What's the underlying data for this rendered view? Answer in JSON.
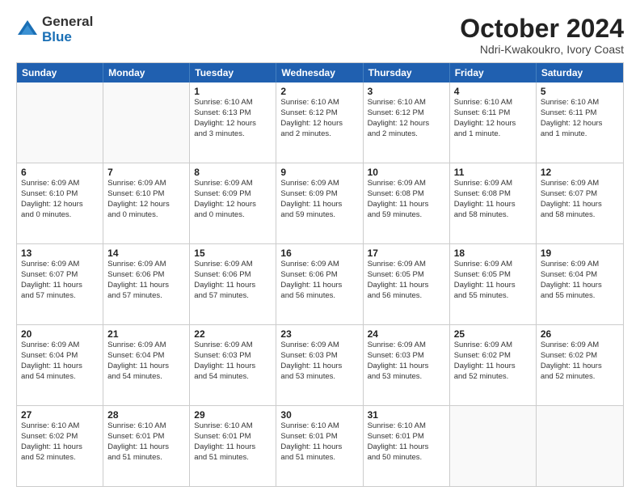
{
  "logo": {
    "general": "General",
    "blue": "Blue"
  },
  "title": "October 2024",
  "location": "Ndri-Kwakoukro, Ivory Coast",
  "header_days": [
    "Sunday",
    "Monday",
    "Tuesday",
    "Wednesday",
    "Thursday",
    "Friday",
    "Saturday"
  ],
  "weeks": [
    [
      {
        "day": "",
        "info": ""
      },
      {
        "day": "",
        "info": ""
      },
      {
        "day": "1",
        "info": "Sunrise: 6:10 AM\nSunset: 6:13 PM\nDaylight: 12 hours\nand 3 minutes."
      },
      {
        "day": "2",
        "info": "Sunrise: 6:10 AM\nSunset: 6:12 PM\nDaylight: 12 hours\nand 2 minutes."
      },
      {
        "day": "3",
        "info": "Sunrise: 6:10 AM\nSunset: 6:12 PM\nDaylight: 12 hours\nand 2 minutes."
      },
      {
        "day": "4",
        "info": "Sunrise: 6:10 AM\nSunset: 6:11 PM\nDaylight: 12 hours\nand 1 minute."
      },
      {
        "day": "5",
        "info": "Sunrise: 6:10 AM\nSunset: 6:11 PM\nDaylight: 12 hours\nand 1 minute."
      }
    ],
    [
      {
        "day": "6",
        "info": "Sunrise: 6:09 AM\nSunset: 6:10 PM\nDaylight: 12 hours\nand 0 minutes."
      },
      {
        "day": "7",
        "info": "Sunrise: 6:09 AM\nSunset: 6:10 PM\nDaylight: 12 hours\nand 0 minutes."
      },
      {
        "day": "8",
        "info": "Sunrise: 6:09 AM\nSunset: 6:09 PM\nDaylight: 12 hours\nand 0 minutes."
      },
      {
        "day": "9",
        "info": "Sunrise: 6:09 AM\nSunset: 6:09 PM\nDaylight: 11 hours\nand 59 minutes."
      },
      {
        "day": "10",
        "info": "Sunrise: 6:09 AM\nSunset: 6:08 PM\nDaylight: 11 hours\nand 59 minutes."
      },
      {
        "day": "11",
        "info": "Sunrise: 6:09 AM\nSunset: 6:08 PM\nDaylight: 11 hours\nand 58 minutes."
      },
      {
        "day": "12",
        "info": "Sunrise: 6:09 AM\nSunset: 6:07 PM\nDaylight: 11 hours\nand 58 minutes."
      }
    ],
    [
      {
        "day": "13",
        "info": "Sunrise: 6:09 AM\nSunset: 6:07 PM\nDaylight: 11 hours\nand 57 minutes."
      },
      {
        "day": "14",
        "info": "Sunrise: 6:09 AM\nSunset: 6:06 PM\nDaylight: 11 hours\nand 57 minutes."
      },
      {
        "day": "15",
        "info": "Sunrise: 6:09 AM\nSunset: 6:06 PM\nDaylight: 11 hours\nand 57 minutes."
      },
      {
        "day": "16",
        "info": "Sunrise: 6:09 AM\nSunset: 6:06 PM\nDaylight: 11 hours\nand 56 minutes."
      },
      {
        "day": "17",
        "info": "Sunrise: 6:09 AM\nSunset: 6:05 PM\nDaylight: 11 hours\nand 56 minutes."
      },
      {
        "day": "18",
        "info": "Sunrise: 6:09 AM\nSunset: 6:05 PM\nDaylight: 11 hours\nand 55 minutes."
      },
      {
        "day": "19",
        "info": "Sunrise: 6:09 AM\nSunset: 6:04 PM\nDaylight: 11 hours\nand 55 minutes."
      }
    ],
    [
      {
        "day": "20",
        "info": "Sunrise: 6:09 AM\nSunset: 6:04 PM\nDaylight: 11 hours\nand 54 minutes."
      },
      {
        "day": "21",
        "info": "Sunrise: 6:09 AM\nSunset: 6:04 PM\nDaylight: 11 hours\nand 54 minutes."
      },
      {
        "day": "22",
        "info": "Sunrise: 6:09 AM\nSunset: 6:03 PM\nDaylight: 11 hours\nand 54 minutes."
      },
      {
        "day": "23",
        "info": "Sunrise: 6:09 AM\nSunset: 6:03 PM\nDaylight: 11 hours\nand 53 minutes."
      },
      {
        "day": "24",
        "info": "Sunrise: 6:09 AM\nSunset: 6:03 PM\nDaylight: 11 hours\nand 53 minutes."
      },
      {
        "day": "25",
        "info": "Sunrise: 6:09 AM\nSunset: 6:02 PM\nDaylight: 11 hours\nand 52 minutes."
      },
      {
        "day": "26",
        "info": "Sunrise: 6:09 AM\nSunset: 6:02 PM\nDaylight: 11 hours\nand 52 minutes."
      }
    ],
    [
      {
        "day": "27",
        "info": "Sunrise: 6:10 AM\nSunset: 6:02 PM\nDaylight: 11 hours\nand 52 minutes."
      },
      {
        "day": "28",
        "info": "Sunrise: 6:10 AM\nSunset: 6:01 PM\nDaylight: 11 hours\nand 51 minutes."
      },
      {
        "day": "29",
        "info": "Sunrise: 6:10 AM\nSunset: 6:01 PM\nDaylight: 11 hours\nand 51 minutes."
      },
      {
        "day": "30",
        "info": "Sunrise: 6:10 AM\nSunset: 6:01 PM\nDaylight: 11 hours\nand 51 minutes."
      },
      {
        "day": "31",
        "info": "Sunrise: 6:10 AM\nSunset: 6:01 PM\nDaylight: 11 hours\nand 50 minutes."
      },
      {
        "day": "",
        "info": ""
      },
      {
        "day": "",
        "info": ""
      }
    ]
  ]
}
